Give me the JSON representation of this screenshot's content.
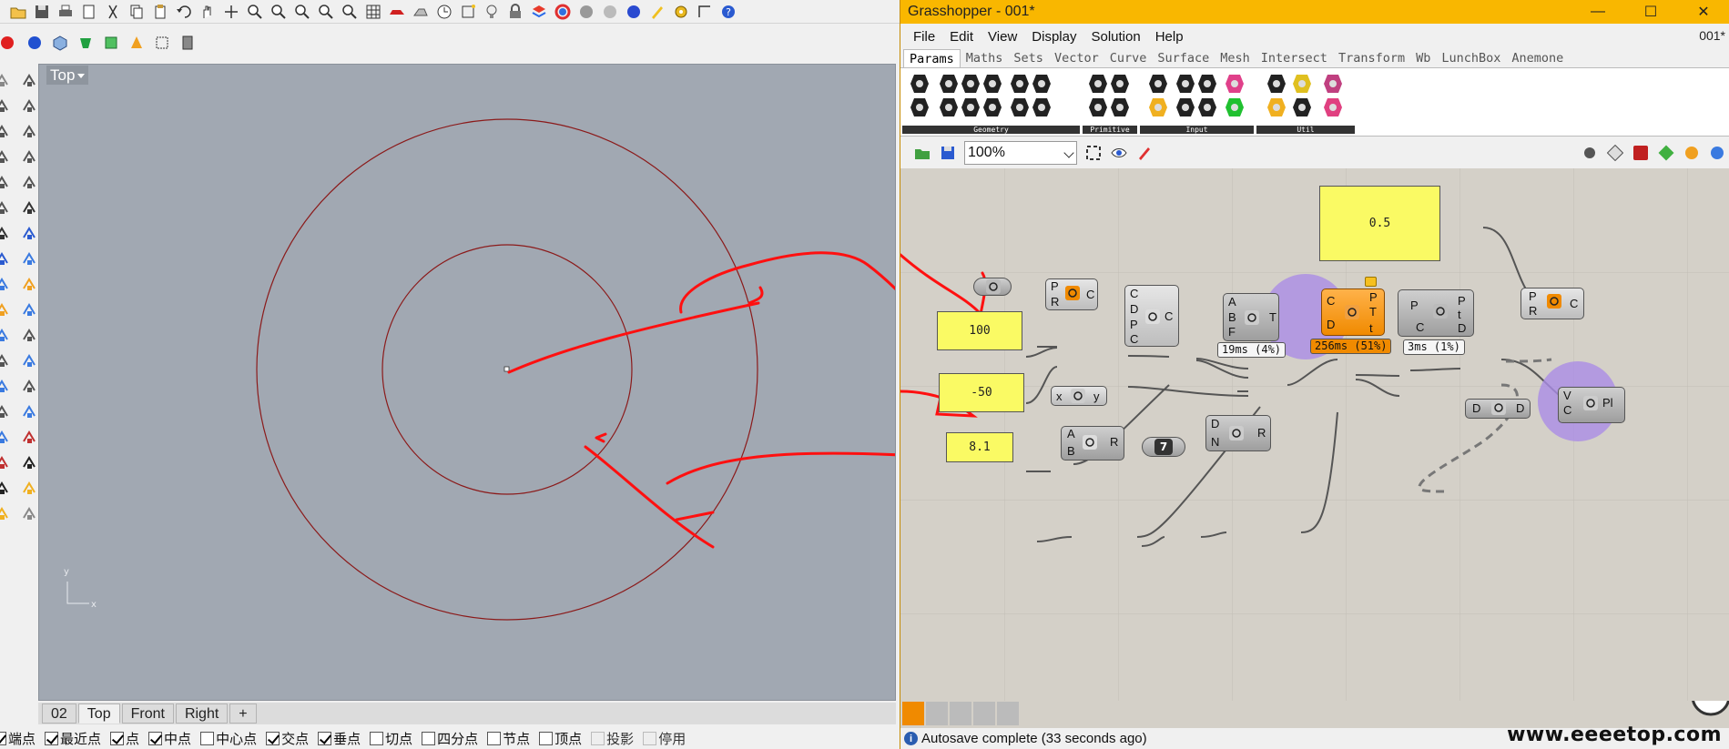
{
  "rhino": {
    "viewport": {
      "label": "Top",
      "axis_x": "x",
      "axis_y": "y"
    },
    "view_tabs": [
      "02",
      "Top",
      "Front",
      "Right",
      "+"
    ],
    "active_view_tab": "Top",
    "osnaps": [
      {
        "label": "端点",
        "checked": true
      },
      {
        "label": "最近点",
        "checked": true
      },
      {
        "label": "点",
        "checked": true
      },
      {
        "label": "中点",
        "checked": true
      },
      {
        "label": "中心点",
        "checked": false
      },
      {
        "label": "交点",
        "checked": true
      },
      {
        "label": "垂点",
        "checked": true
      },
      {
        "label": "切点",
        "checked": false
      },
      {
        "label": "四分点",
        "checked": false
      },
      {
        "label": "节点",
        "checked": false
      },
      {
        "label": "顶点",
        "checked": false
      },
      {
        "label": "投影",
        "checked": false,
        "disabled": true
      },
      {
        "label": "停用",
        "checked": false,
        "disabled": true
      }
    ],
    "circle_color": "#8b1a1a",
    "annotation_color": "#ff1010"
  },
  "grasshopper": {
    "title": "Grasshopper - 001*",
    "doc_name": "001*",
    "window_buttons": {
      "minimize": "—",
      "maximize": "☐",
      "close": "✕"
    },
    "menu": [
      "File",
      "Edit",
      "View",
      "Display",
      "Solution",
      "Help"
    ],
    "tabs": [
      "Params",
      "Maths",
      "Sets",
      "Vector",
      "Curve",
      "Surface",
      "Mesh",
      "Intersect",
      "Transform",
      "Wb",
      "LunchBox",
      "Anemone"
    ],
    "active_tab": "Params",
    "ribbon_groups": [
      "Geometry",
      "Primitive",
      "Input",
      "Util"
    ],
    "zoom": "100%",
    "accent_color": "#f9b700",
    "canvas": {
      "panels": {
        "p05": "0.5",
        "p100": "100",
        "pm50": "-50",
        "p81": "8.1"
      },
      "labels": {
        "circle1_in_p": "P",
        "circle1_in_r": "R",
        "circle1_out": "C",
        "arc_in_c1": "C",
        "arc_in_d": "D",
        "arc_in_p": "P",
        "arc_in_c2": "C",
        "arc_out": "C",
        "tween_a": "A",
        "tween_b": "B",
        "tween_f": "F",
        "tween_out": "T",
        "cp_c": "C",
        "cp_d": "D",
        "cp_p": "P",
        "cp_t": "T",
        "cp_t2": "t",
        "ev_p": "P",
        "ev_c": "C",
        "ev_op": "P",
        "ev_ot": "t",
        "ev_od": "D",
        "c2_p": "P",
        "c2_r": "R",
        "c2_out": "C",
        "neg_x": "x",
        "neg_y": "y",
        "div_a": "A",
        "div_b": "B",
        "div_r": "R",
        "rng_d": "D",
        "rng_n": "N",
        "rng_r": "R",
        "lst_d1": "D",
        "lst_d2": "D",
        "pl_v": "V",
        "pl_c": "C",
        "pl_out": "Pl"
      },
      "timings": {
        "tween": "19ms (4%)",
        "closest": "256ms (51%)",
        "eval": "3ms (1%)"
      },
      "number_7": "7"
    },
    "status": "Autosave complete (33 seconds ago)",
    "watermark": "www.eeeetop.com"
  }
}
